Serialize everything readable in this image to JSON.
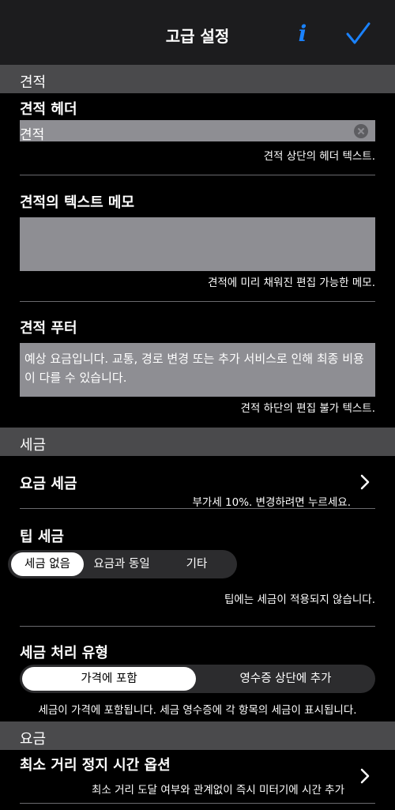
{
  "nav": {
    "title": "고급 설정",
    "info_label": "i"
  },
  "sections": {
    "estimate": "견적",
    "tax": "세금",
    "fare": "요금"
  },
  "estimate": {
    "header_label": "견적 헤더",
    "header_value": "견적",
    "header_hint": "견적 상단의 헤더 텍스트.",
    "memo_label": "견적의 텍스트 메모",
    "memo_value": "",
    "memo_hint": "견적에 미리 채워진 편집 가능한 메모.",
    "footer_label": "견적 푸터",
    "footer_value": "예상 요금입니다. 교통, 경로 변경 또는 추가 서비스로 인해 최종 비용이 다를 수 있습니다.",
    "footer_hint": "견적 하단의 편집 불가 텍스트."
  },
  "tax": {
    "fare_tax_label": "요금 세금",
    "fare_tax_hint": "부가세 10%. 변경하려면 누르세요.",
    "tip_tax_label": "팁 세금",
    "tip_options": [
      "세금 없음",
      "요금과 동일",
      "기타"
    ],
    "tip_selected": "세금 없음",
    "tip_hint": "팁에는 세금이 적용되지 않습니다.",
    "handling_label": "세금 처리 유형",
    "handling_options": [
      "가격에 포함",
      "영수증 상단에 추가"
    ],
    "handling_selected": "가격에 포함",
    "handling_hint": "세금이 가격에 포함됩니다. 세금 영수증에 각 항목의 세금이 표시됩니다."
  },
  "fare": {
    "min_distance_label": "최소 거리 정지 시간 옵션",
    "min_distance_hint": "최소 거리 도달 여부와 관계없이 즉시 미터기에 시간 추가"
  },
  "colors": {
    "accent": "#1a82ff",
    "nav_bg": "#1c1c1e",
    "section_bg": "#4a4a4c",
    "field_bg": "#8e8e93"
  }
}
